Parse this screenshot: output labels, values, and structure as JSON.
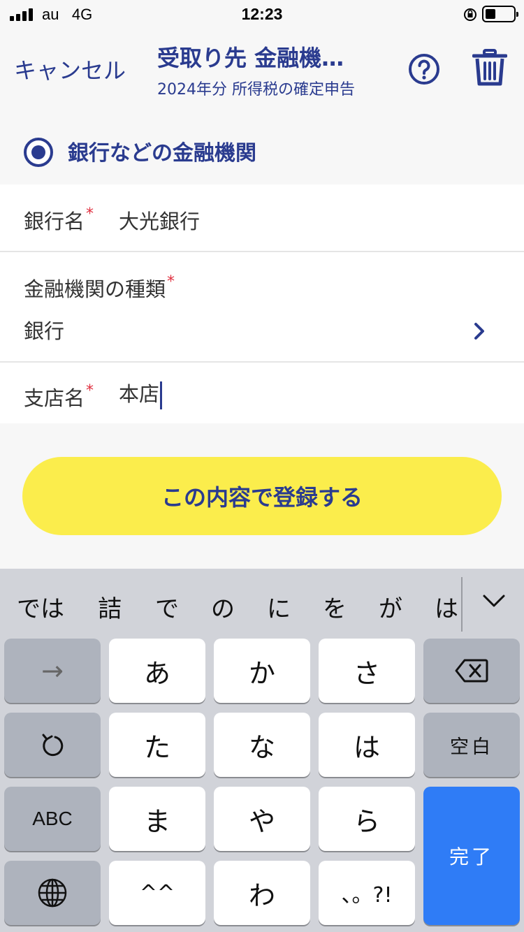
{
  "status_bar": {
    "carrier": "au",
    "network": "4G",
    "time": "12:23"
  },
  "nav": {
    "cancel_label": "キャンセル",
    "title": "受取り先 金融機…",
    "subtitle": "2024年分 所得税の確定申告"
  },
  "radio": {
    "label": "銀行などの金融機関",
    "selected": true
  },
  "form": {
    "bank_name": {
      "label": "銀行名",
      "value": "大光銀行"
    },
    "institution_type": {
      "label": "金融機関の種類",
      "value": "銀行"
    },
    "branch_name": {
      "label": "支店名",
      "value": "本店"
    },
    "required_mark": "*"
  },
  "submit_label": "この内容で登録する",
  "keyboard": {
    "candidates": [
      "では",
      "詰",
      "で",
      "の",
      "に",
      "を",
      "が",
      "は"
    ],
    "keys": {
      "row1": [
        "→",
        "あ",
        "か",
        "さ"
      ],
      "row2": [
        "た",
        "な",
        "は",
        "空白"
      ],
      "row3": [
        "ABC",
        "ま",
        "や",
        "ら"
      ],
      "row4": [
        "^^",
        "わ",
        "、。?!"
      ],
      "done": "完了"
    }
  },
  "colors": {
    "accent": "#2a3b8f",
    "button_yellow": "#fbed4c",
    "required": "#e03040",
    "keyboard_blue": "#2f7cf6"
  }
}
